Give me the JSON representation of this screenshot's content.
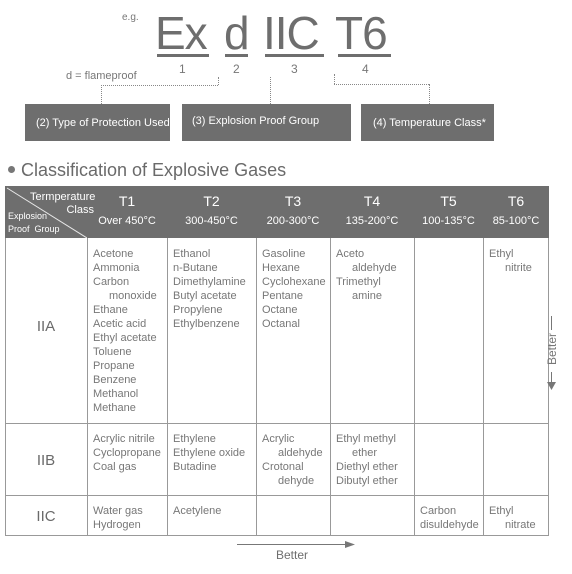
{
  "example": {
    "prefix": "e.g.",
    "parts": [
      {
        "text": "Ex",
        "number": "1"
      },
      {
        "text": "d",
        "number": "2"
      },
      {
        "text": "IIC",
        "number": "3"
      },
      {
        "text": "T6",
        "number": "4"
      }
    ],
    "note": "d = flameproof",
    "boxes": [
      "(2) Type of Protection Used",
      "(3) Explosion Proof Group",
      "(4) Temperature Class*"
    ]
  },
  "section": {
    "title": "Classification of Explosive Gases"
  },
  "table": {
    "corner": {
      "top_line1": "Termperature",
      "top_line2": "Class",
      "bottom_line1": "Explosion",
      "bottom_line2": "Proof  Group"
    },
    "columns": [
      {
        "class": "T1",
        "range": "Over 450°C"
      },
      {
        "class": "T2",
        "range": "300-450°C"
      },
      {
        "class": "T3",
        "range": "200-300°C"
      },
      {
        "class": "T4",
        "range": "135-200°C"
      },
      {
        "class": "T5",
        "range": "100-135°C"
      },
      {
        "class": "T6",
        "range": "85-100°C"
      }
    ],
    "rows": [
      {
        "group": "IIA",
        "cells": [
          [
            "Acetone",
            "Ammonia",
            "Carbon",
            "  monoxide",
            "Ethane",
            "Acetic acid",
            "Ethyl acetate",
            "Toluene",
            "Propane",
            "Benzene",
            "Methanol",
            "Methane"
          ],
          [
            "Ethanol",
            "n-Butane",
            "Dimethylamine",
            "Butyl acetate",
            "Propylene",
            "Ethylbenzene"
          ],
          [
            "Gasoline",
            "Hexane",
            "Cyclohexane",
            "Pentane",
            "Octane",
            "Octanal"
          ],
          [
            "Aceto",
            "  aldehyde",
            "Trimethyl",
            "  amine"
          ],
          [],
          [
            "Ethyl",
            "  nitrite"
          ]
        ]
      },
      {
        "group": "IIB",
        "cells": [
          [
            "Acrylic nitrile",
            "Cyclopropane",
            "Coal gas"
          ],
          [
            "Ethylene",
            "Ethylene oxide",
            "Butadine"
          ],
          [
            "Acrylic",
            "  aldehyde",
            "Crotonal",
            "  dehyde"
          ],
          [
            "Ethyl methyl",
            "  ether",
            "Diethyl ether",
            "Dibutyl ether"
          ],
          [],
          []
        ]
      },
      {
        "group": "IIC",
        "cells": [
          [
            "Water gas",
            "Hydrogen"
          ],
          [
            "Acetylene"
          ],
          [],
          [],
          [
            "Carbon",
            "disuldehyde"
          ],
          [
            "Ethyl",
            "  nitrate"
          ]
        ]
      }
    ],
    "vertical_arrow_label": "Better",
    "horizontal_arrow_label": "Better"
  },
  "colors": {
    "header_bg": "#6e6e6e",
    "grid": "#999999",
    "text": "#777777"
  }
}
